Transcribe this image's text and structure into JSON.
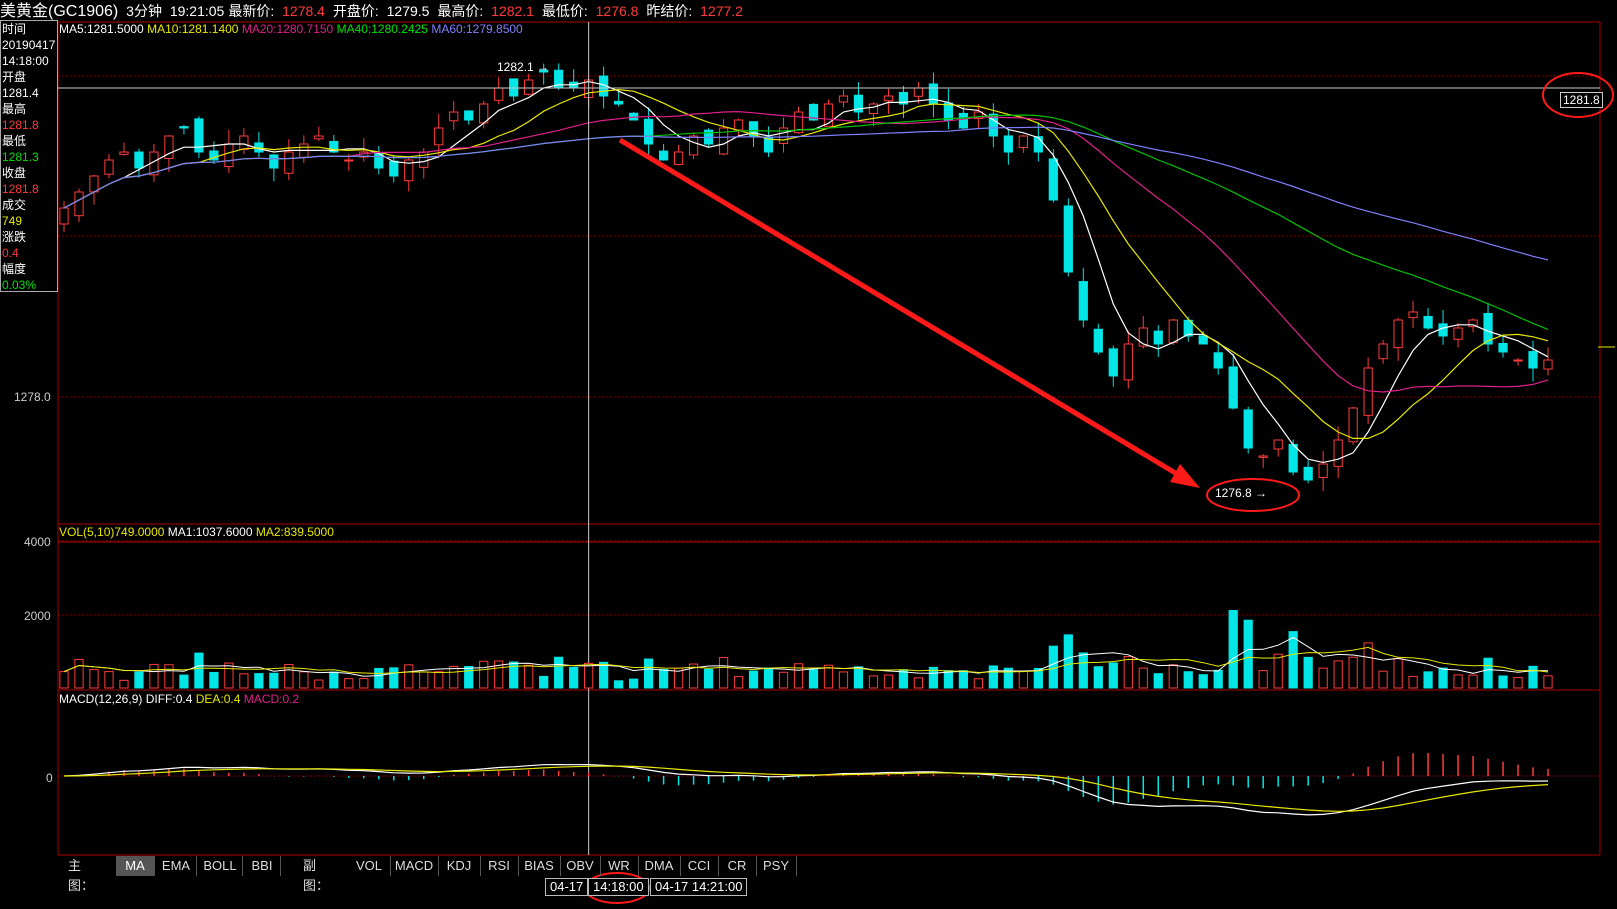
{
  "header": {
    "title": "美黄金(GC1906)",
    "period": "3分钟",
    "time": "19:21:05",
    "latest_label": "最新价:",
    "latest_value": "1278.4",
    "open_label": "开盘价:",
    "open_value": "1279.5",
    "high_label": "最高价:",
    "high_value": "1282.1",
    "low_label": "最低价:",
    "low_value": "1276.8",
    "prev_label": "昨结价:",
    "prev_value": "1277.2"
  },
  "infobox": {
    "time_label": "时间",
    "date": "20190417",
    "clock": "14:18:00",
    "open_label": "开盘",
    "open": "1281.4",
    "high_label": "最高",
    "high": "1281.8",
    "low_label": "最低",
    "low": "1281.3",
    "close_label": "收盘",
    "close": "1281.8",
    "vol_label": "成交",
    "vol": "749",
    "change_label": "涨跌",
    "change": "0.4",
    "amp_label": "幅度",
    "amp": "0.03%"
  },
  "ma_legend": {
    "ma5": "MA5:1281.5000",
    "ma10": "MA10:1281.1400",
    "ma20": "MA20:1280.7150",
    "ma40": "MA40:1280.2425",
    "ma60": "MA60:1279.8500"
  },
  "vol_legend": {
    "vol": "VOL(5,10)749.0000",
    "ma1": "MA1:1037.6000",
    "ma2": "MA2:839.5000"
  },
  "macd_legend": {
    "macd": "MACD(12,26,9)",
    "diff": "DIFF:0.4",
    "dea": "DEA:0.4",
    "macdv": "MACD:0.2"
  },
  "axis": {
    "price_1278": "1278.0",
    "vol_4000": "4000",
    "vol_2000": "2000",
    "macd_0": "0"
  },
  "annotations": {
    "high_mark": "1282.1",
    "low_mark": "1276.8",
    "cursor_price": "1281.8"
  },
  "bottom": {
    "main_label": "主图：",
    "sub_label": "副图：",
    "main_tabs": [
      "MA",
      "EMA",
      "BOLL",
      "BBI"
    ],
    "sub_tabs": [
      "VOL",
      "MACD",
      "KDJ",
      "RSI",
      "BIAS",
      "OBV",
      "WR",
      "DMA",
      "CCI",
      "CR",
      "PSY"
    ],
    "time_date": "04-17",
    "time_cursor": "14:18:00",
    "time_next": "04-17 14:21:00"
  },
  "colors": {
    "up": "#ff3b3b",
    "down": "#00e5e5",
    "ma5": "#ffffff",
    "ma10": "#e8e800",
    "ma20": "#e0208a",
    "ma40": "#00c000",
    "ma60": "#8080ff",
    "arrow": "#ff1a1a"
  },
  "chart_data": {
    "type": "candlestick",
    "ylim": [
      1276.4,
      1282.6
    ],
    "close_series": [
      1280.3,
      1280.5,
      1280.7,
      1280.9,
      1281.0,
      1280.8,
      1281.0,
      1281.2,
      1281.3,
      1281.0,
      1280.9,
      1281.1,
      1281.2,
      1281.0,
      1280.8,
      1281.0,
      1281.1,
      1281.2,
      1281.0,
      1280.9,
      1281.0,
      1280.8,
      1280.7,
      1280.9,
      1281.0,
      1281.3,
      1281.5,
      1281.4,
      1281.6,
      1281.8,
      1281.7,
      1281.9,
      1282.0,
      1281.8,
      1281.8,
      1281.9,
      1281.7,
      1281.6,
      1281.4,
      1281.1,
      1280.9,
      1281.0,
      1281.2,
      1281.1,
      1281.3,
      1281.4,
      1281.2,
      1281.0,
      1281.3,
      1281.5,
      1281.4,
      1281.6,
      1281.7,
      1281.5,
      1281.6,
      1281.7,
      1281.6,
      1281.8,
      1281.6,
      1281.4,
      1281.3,
      1281.5,
      1281.2,
      1281.0,
      1281.2,
      1281.0,
      1280.4,
      1279.5,
      1278.9,
      1278.5,
      1278.2,
      1278.6,
      1278.8,
      1278.6,
      1278.9,
      1278.7,
      1278.6,
      1278.3,
      1277.8,
      1277.3,
      1277.2,
      1277.4,
      1277.0,
      1276.9,
      1277.1,
      1277.4,
      1277.8,
      1278.3,
      1278.6,
      1278.9,
      1279.0,
      1278.8,
      1278.7,
      1278.8,
      1278.9,
      1278.6,
      1278.5,
      1278.4,
      1278.3,
      1278.4
    ],
    "annotated_high": 1282.1,
    "annotated_low": 1276.8,
    "vol_ylim": [
      0,
      4500
    ],
    "vol_ticks": [
      2000,
      4000
    ],
    "macd_zero": 0
  }
}
